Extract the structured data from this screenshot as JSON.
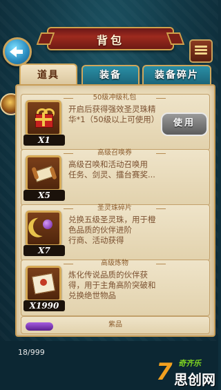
{
  "header": {
    "title": "背包"
  },
  "tabs": [
    {
      "label": "道具",
      "active": true
    },
    {
      "label": "装备",
      "active": false
    },
    {
      "label": "装备碎片",
      "active": false
    }
  ],
  "items": [
    {
      "category": "50级冲级礼包",
      "count": "X1",
      "description": "开启后获得强效圣灵珠精华*1（50级以上可使用）",
      "action": "使用",
      "icon": "gift-icon"
    },
    {
      "category": "高级召唤券",
      "count": "X5",
      "description": "高级召唤和活动召唤用\n任务、剑灵、擂台赛奖...",
      "icon": "scroll-icon"
    },
    {
      "category": "圣灵珠碎片",
      "count": "X7",
      "description": "兑换五级圣灵珠，用于橙色品质的伙伴进阶\n行商、活动获得",
      "icon": "moon-orb-icon"
    },
    {
      "category": "高级炼物",
      "count": "X1990",
      "description": "炼化传说品质的伙伴获得，用于主角高阶突破和兑换绝世物品",
      "icon": "book-icon"
    }
  ],
  "next_category": {
    "label": "紫品"
  },
  "footer": {
    "capacity": "18/999"
  },
  "watermark": {
    "number": "7",
    "sub": "奇齐乐",
    "text": "思创网"
  },
  "colors": {
    "accent_gold": "#d0a24c",
    "title_red": "#9d2a1e",
    "panel": "#e9dab8",
    "tab_teal": "#2a8fa6"
  }
}
